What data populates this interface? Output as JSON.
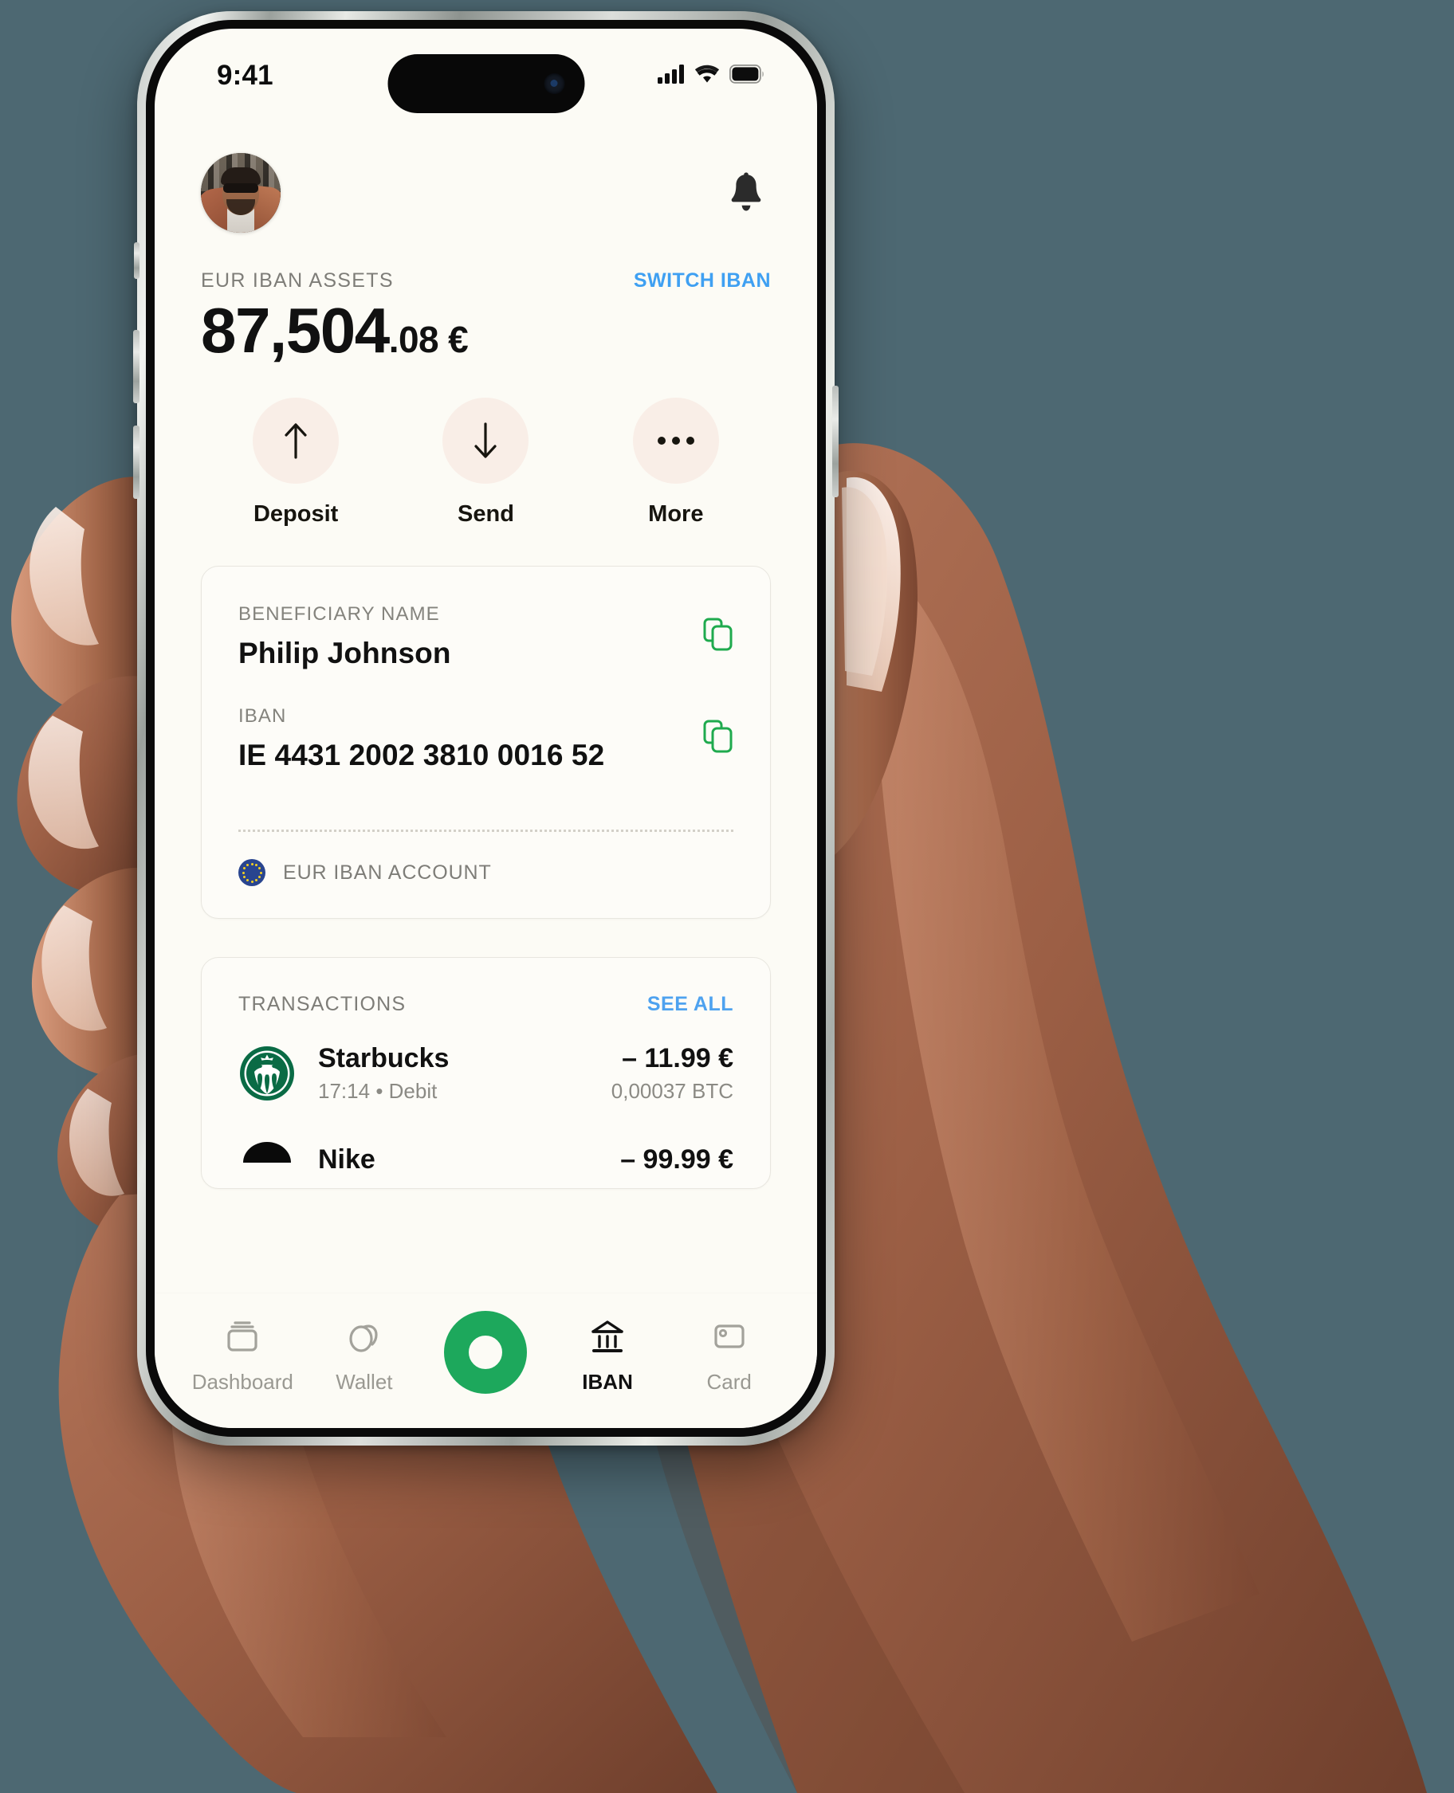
{
  "theme": {
    "background": "#4d6872",
    "screen_bg": "#fcfbf5",
    "accent_green": "#1da85c",
    "link_blue": "#3fa0f2",
    "action_circle": "#f9eee7",
    "copy_green": "#1faa4e"
  },
  "status_bar": {
    "time": "9:41",
    "cellular_icon": "signal-bars-icon",
    "wifi_icon": "wifi-icon",
    "battery_icon": "battery-icon"
  },
  "header": {
    "avatar": "user-avatar",
    "notification_icon": "bell-icon"
  },
  "balance": {
    "label": "EUR IBAN ASSETS",
    "switch_link": "SWITCH IBAN",
    "amount_main": "87,504",
    "amount_decimal": ".08",
    "currency": "€"
  },
  "actions": [
    {
      "label": "Deposit",
      "icon": "arrow-up-icon"
    },
    {
      "label": "Send",
      "icon": "arrow-down-icon"
    },
    {
      "label": "More",
      "icon": "ellipsis-icon"
    }
  ],
  "iban_card": {
    "beneficiary_label": "BENEFICIARY NAME",
    "beneficiary_value": "Philip Johnson",
    "iban_label": "IBAN",
    "iban_value": "IE 4431 2002 3810 0016 52",
    "copy_icon": "copy-icon",
    "account_type": "EUR IBAN ACCOUNT",
    "account_flag": "eu-flag-icon"
  },
  "transactions": {
    "title": "TRANSACTIONS",
    "see_all": "SEE ALL",
    "items": [
      {
        "merchant": "Starbucks",
        "logo": "starbucks-logo",
        "time": "17:14",
        "separator": "•",
        "type": "Debit",
        "amount": "– 11.99 €",
        "crypto": "0,00037 BTC"
      },
      {
        "merchant": "Nike",
        "logo": "nike-logo",
        "time": "",
        "separator": "",
        "type": "",
        "amount": "– 99.99 €",
        "crypto": ""
      }
    ]
  },
  "bottom_nav": {
    "items": [
      {
        "label": "Dashboard",
        "icon": "dashboard-icon",
        "active": false
      },
      {
        "label": "Wallet",
        "icon": "wallet-icon",
        "active": false
      },
      {
        "label": "IBAN",
        "icon": "bank-icon",
        "active": true
      },
      {
        "label": "Card",
        "icon": "card-icon",
        "active": false
      }
    ],
    "center_button": "app-logo-o-button"
  }
}
